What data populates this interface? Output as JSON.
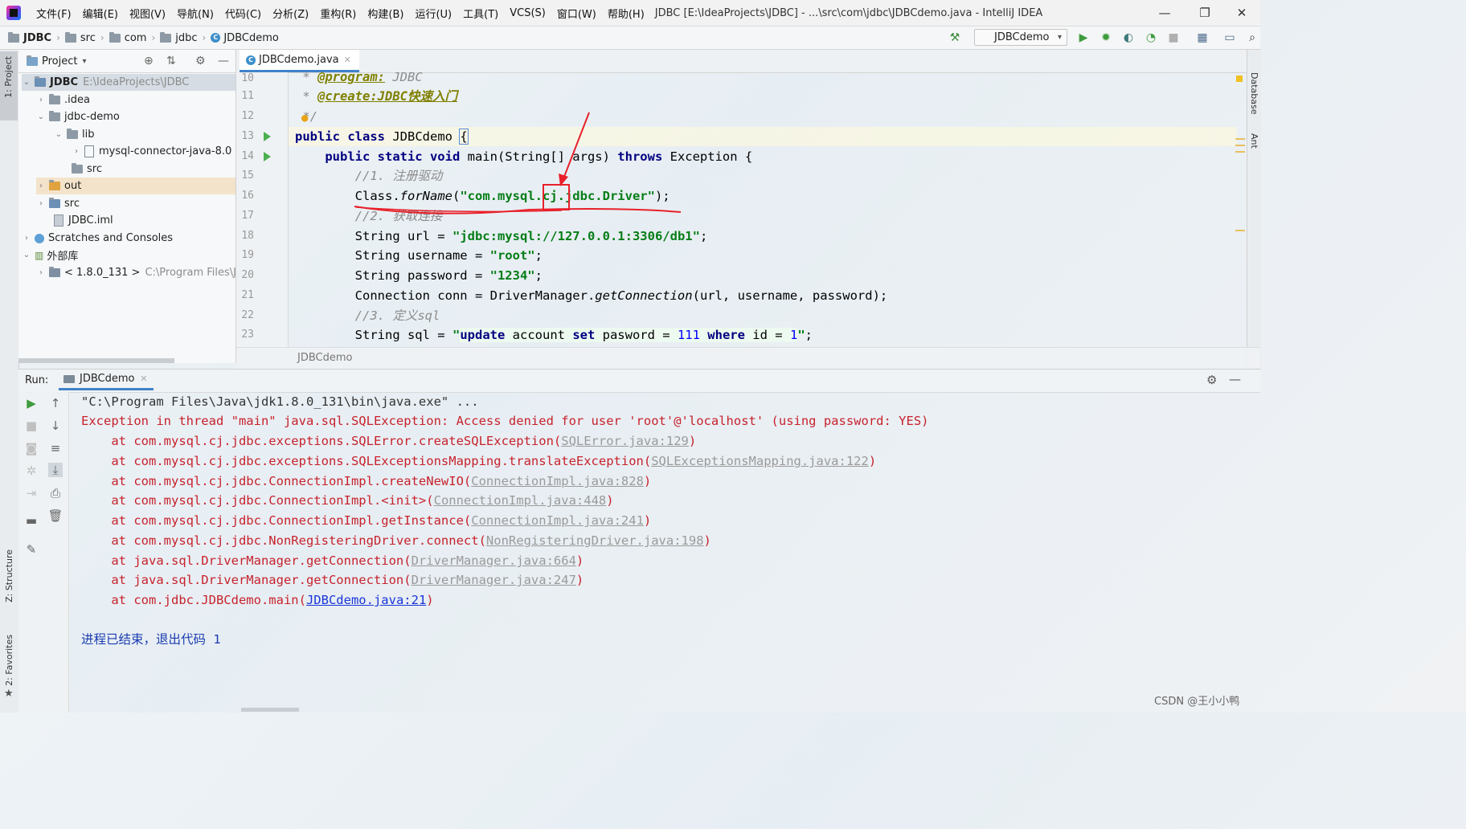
{
  "menu": {
    "items": [
      "文件(F)",
      "编辑(E)",
      "视图(V)",
      "导航(N)",
      "代码(C)",
      "分析(Z)",
      "重构(R)",
      "构建(B)",
      "运行(U)",
      "工具(T)",
      "VCS(S)",
      "窗口(W)",
      "帮助(H)"
    ],
    "window_title": "JDBC [E:\\IdeaProjects\\JDBC] - ...\\src\\com\\jdbc\\JDBCdemo.java - IntelliJ IDEA"
  },
  "navbar": {
    "crumbs": [
      "JDBC",
      "src",
      "com",
      "jdbc",
      "JDBCdemo"
    ],
    "run_config": "JDBCdemo"
  },
  "side_tools": {
    "project": "1: Project",
    "structure": "Z: Structure",
    "favorites": "2: Favorites",
    "database": "Database",
    "ant": "Ant"
  },
  "project_panel": {
    "title": "Project",
    "tree": [
      {
        "label": "JDBC",
        "extra": "E:\\IdeaProjects\\JDBC"
      },
      {
        "label": ".idea"
      },
      {
        "label": "jdbc-demo"
      },
      {
        "label": "lib"
      },
      {
        "label": "mysql-connector-java-8.0"
      },
      {
        "label": "src"
      },
      {
        "label": "out"
      },
      {
        "label": "src"
      },
      {
        "label": "JDBC.iml"
      },
      {
        "label": "Scratches and Consoles"
      },
      {
        "label": "外部库"
      },
      {
        "label": "< 1.8.0_131 >",
        "extra": "C:\\Program Files\\J"
      }
    ]
  },
  "editor": {
    "tab_label": "JDBCdemo.java",
    "line_numbers": [
      "10",
      "11",
      "12",
      "13",
      "14",
      "15",
      "16",
      "17",
      "18",
      "19",
      "20",
      "21",
      "22",
      "23"
    ],
    "breadcrumb": "JDBCdemo",
    "code": {
      "l10_ann": "@program:",
      "l10_rest": " JDBC",
      "l11_ann": "@create:JDBC快速入门",
      "l13_a": "public class ",
      "l13_b": "JDBCdemo ",
      "l13_c": "{",
      "l14_kw1": "public static void ",
      "l14_b": "main(String[] args) ",
      "l14_kw2": "throws ",
      "l14_c": "Exception {",
      "l15": "//1. 注册驱动",
      "l16_a": "Class.",
      "l16_m": "forName",
      "l16_b": "(",
      "l16_s": "\"com.mysql.cj.jdbc.Driver\"",
      "l16_c": ");",
      "l17": "//2. 获取连接",
      "l18_a": "String url = ",
      "l18_s": "\"jdbc:mysql://127.0.0.1:3306/db1\"",
      "l18_c": ";",
      "l19_a": "String username = ",
      "l19_s": "\"root\"",
      "l19_c": ";",
      "l20_a": "String password = ",
      "l20_s": "\"1234\"",
      "l20_c": ";",
      "l21_a": "Connection conn = DriverManager.",
      "l21_m": "getConnection",
      "l21_b": "(url, username, password);",
      "l22": "//3. 定义sql",
      "l23_a": "String sql = ",
      "l23_s1": "\"",
      "l23_k1": "update ",
      "l23_t1": "account ",
      "l23_k2": "set ",
      "l23_t2": "pasword = ",
      "l23_n1": "111 ",
      "l23_k3": "where ",
      "l23_t3": "id = ",
      "l23_n2": "1",
      "l23_s2": "\"",
      "l23_c": ";"
    }
  },
  "run_panel": {
    "label": "Run:",
    "tab": "JDBCdemo",
    "console": {
      "cmd": "\"C:\\Program Files\\Java\\jdk1.8.0_131\\bin\\java.exe\" ...",
      "exception": "Exception in thread \"main\" java.sql.SQLException: Access denied for user 'root'@'localhost' (using password: YES)",
      "frames": [
        {
          "text": "    at com.mysql.cj.jdbc.exceptions.SQLError.createSQLException(",
          "link": "SQLError.java:129",
          "end": ")"
        },
        {
          "text": "    at com.mysql.cj.jdbc.exceptions.SQLExceptionsMapping.translateException(",
          "link": "SQLExceptionsMapping.java:122",
          "end": ")"
        },
        {
          "text": "    at com.mysql.cj.jdbc.ConnectionImpl.createNewIO(",
          "link": "ConnectionImpl.java:828",
          "end": ")"
        },
        {
          "text": "    at com.mysql.cj.jdbc.ConnectionImpl.<init>(",
          "link": "ConnectionImpl.java:448",
          "end": ")"
        },
        {
          "text": "    at com.mysql.cj.jdbc.ConnectionImpl.getInstance(",
          "link": "ConnectionImpl.java:241",
          "end": ")"
        },
        {
          "text": "    at com.mysql.cj.jdbc.NonRegisteringDriver.connect(",
          "link": "NonRegisteringDriver.java:198",
          "end": ")"
        },
        {
          "text": "    at java.sql.DriverManager.getConnection(",
          "link": "DriverManager.java:664",
          "end": ")"
        },
        {
          "text": "    at java.sql.DriverManager.getConnection(",
          "link": "DriverManager.java:247",
          "end": ")"
        },
        {
          "text": "    at com.jdbc.JDBCdemo.main(",
          "link": "JDBCdemo.java:21",
          "end": ")"
        }
      ],
      "exit_message": "进程已结束，退出代码 1"
    }
  },
  "watermark": "CSDN @王小小鸭",
  "colors": {
    "keyword": "#000080",
    "string": "#067d17",
    "error": "#c7222d",
    "annotation_red": "#e8202a"
  }
}
